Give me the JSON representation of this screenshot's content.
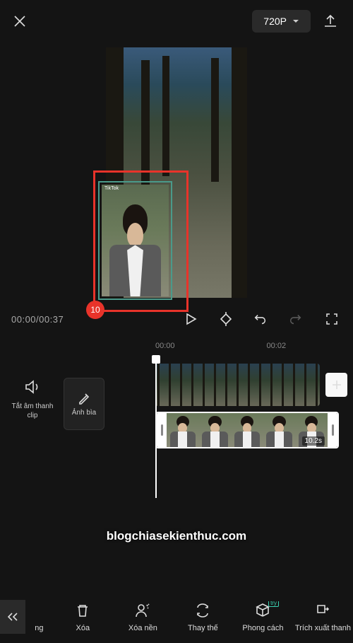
{
  "topbar": {
    "resolution": "720P"
  },
  "preview": {
    "overlay_watermark": "TikTok",
    "badge_number": "10"
  },
  "controls": {
    "timecode": "00:00/00:37"
  },
  "ruler": {
    "t0": "00:00",
    "t1": "00:02"
  },
  "left_tools": {
    "mute_label": "Tắt âm thanh clip",
    "cover_label": "Ảnh bìa"
  },
  "pip_track": {
    "duration_label": "10.2s"
  },
  "watermark": "blogchiasekienthuc.com",
  "bottom_nav": {
    "item_cut": "ng",
    "item0": "Xóa",
    "item1": "Xóa nền",
    "item2": "Thay thế",
    "item3": "Phong cách",
    "item3_badge": "try",
    "item4": "Trích xuất thanh"
  }
}
